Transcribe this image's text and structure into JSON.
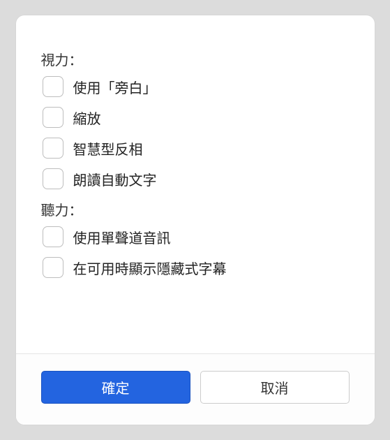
{
  "sections": {
    "vision": {
      "label": "視力：",
      "options": [
        {
          "label": "使用「旁白」",
          "checked": false
        },
        {
          "label": "縮放",
          "checked": false
        },
        {
          "label": "智慧型反相",
          "checked": false
        },
        {
          "label": "朗讀自動文字",
          "checked": false
        }
      ]
    },
    "hearing": {
      "label": "聽力：",
      "options": [
        {
          "label": "使用單聲道音訊",
          "checked": false
        },
        {
          "label": "在可用時顯示隱藏式字幕",
          "checked": false
        }
      ]
    }
  },
  "buttons": {
    "confirm": "確定",
    "cancel": "取消"
  }
}
